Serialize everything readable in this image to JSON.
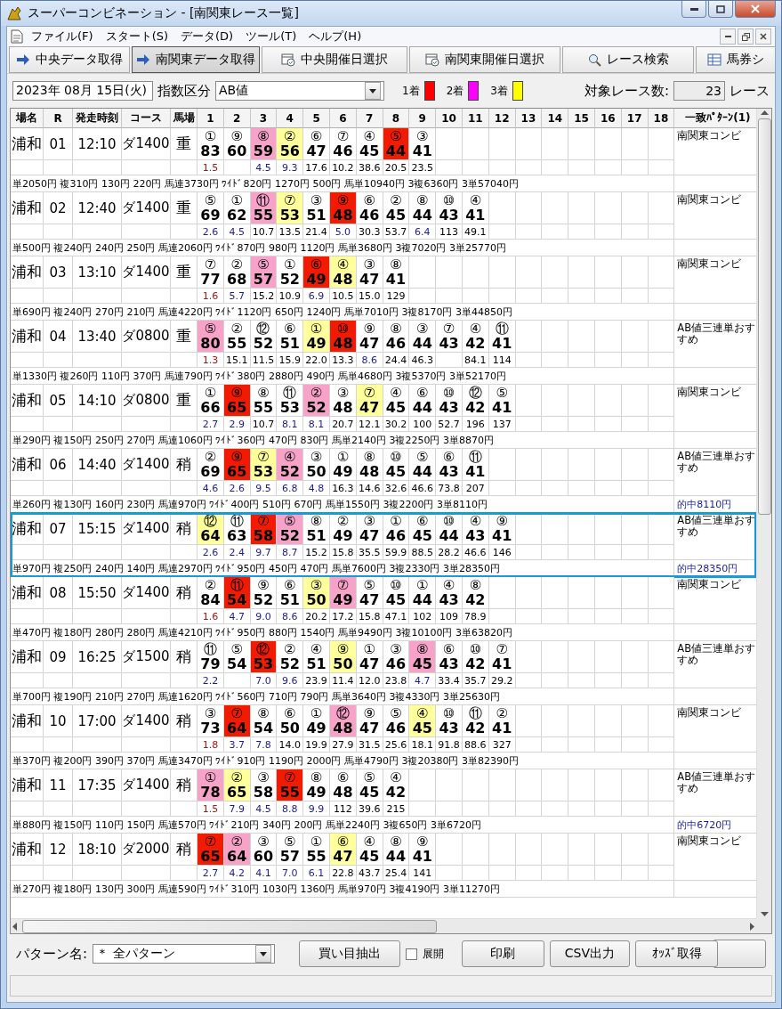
{
  "window": {
    "title": "スーパーコンビネーション - [南関東レース一覧]"
  },
  "menu": [
    "ファイル(F)",
    "スタート(S)",
    "データ(D)",
    "ツール(T)",
    "ヘルプ(H)"
  ],
  "toolbar": [
    {
      "label": "中央データ取得",
      "kind": "arrow",
      "selected": false
    },
    {
      "label": "南関東データ取得",
      "kind": "arrow",
      "selected": true
    },
    {
      "label": "中央開催日選択",
      "kind": "calendar",
      "selected": false
    },
    {
      "label": "南関東開催日選択",
      "kind": "calendar",
      "selected": false
    },
    {
      "label": "レース検索",
      "kind": "search",
      "selected": false
    },
    {
      "label": "馬券シ",
      "kind": "table",
      "selected": false
    }
  ],
  "filter": {
    "date": "2023年 08月 15日(火)",
    "index_label": "指数区分",
    "index_value": "AB値",
    "legend": [
      {
        "label": "1着",
        "color": "#ff0000"
      },
      {
        "label": "2着",
        "color": "#ff00ff"
      },
      {
        "label": "3着",
        "color": "#ffff00"
      }
    ],
    "count_label": "対象レース数:",
    "count": "23",
    "count_unit": "レース"
  },
  "table": {
    "columns": [
      "場名",
      "R",
      "発走時刻",
      "コース",
      "馬場",
      "1",
      "2",
      "3",
      "4",
      "5",
      "6",
      "7",
      "8",
      "9",
      "10",
      "11",
      "12",
      "13",
      "14",
      "15",
      "16",
      "17",
      "18",
      "一致ﾊﾟﾀｰﾝ(1)"
    ]
  },
  "races": [
    {
      "venue": "浦和",
      "r": "01",
      "time": "12:10",
      "course": "ダ1400",
      "track": "重",
      "selected": false,
      "pattern": "南関東コンビ",
      "payout": "単2050円 複310円 130円 220円 馬連3730円 ﾜｲﾄﾞ820円 1270円 500円 馬単10940円 3複6360円 3単57040円",
      "horses": [
        {
          "no": "①",
          "score": "83",
          "color": "#ffffff",
          "odds": {
            "text": "1.5",
            "color": "#a01818"
          }
        },
        {
          "no": "⑨",
          "score": "60",
          "color": "#ffffff"
        },
        {
          "no": "⑧",
          "score": "59",
          "color": "#f6a2c9",
          "odds": {
            "text": "4.5",
            "color": "#1c1c8c"
          }
        },
        {
          "no": "②",
          "score": "56",
          "color": "#ffff9c",
          "odds": {
            "text": "9.3",
            "color": "#1c1c8c"
          }
        },
        {
          "no": "⑥",
          "score": "47",
          "color": "#ffffff",
          "odds": {
            "text": "17.6",
            "color": "#000000"
          }
        },
        {
          "no": "⑦",
          "score": "46",
          "color": "#ffffff",
          "odds": {
            "text": "10.2",
            "color": "#000000"
          }
        },
        {
          "no": "④",
          "score": "45",
          "color": "#ffffff",
          "odds": {
            "text": "38.6",
            "color": "#000000"
          }
        },
        {
          "no": "⑤",
          "score": "44",
          "color": "#f21a00",
          "odds": {
            "text": "20.5",
            "color": "#000000"
          }
        },
        {
          "no": "③",
          "score": "41",
          "color": "#ffffff",
          "odds": {
            "text": "23.5",
            "color": "#000000"
          }
        }
      ]
    },
    {
      "venue": "浦和",
      "r": "02",
      "time": "12:40",
      "course": "ダ1400",
      "track": "重",
      "selected": false,
      "pattern": "南関東コンビ",
      "payout": "単500円 複240円 240円 250円 馬連2060円 ﾜｲﾄﾞ870円 980円 1120円 馬単3680円 3複7020円 3単25770円",
      "horses": [
        {
          "no": "⑤",
          "score": "69",
          "color": "#ffffff",
          "odds": {
            "text": "2.6",
            "color": "#1c1c8c"
          }
        },
        {
          "no": "①",
          "score": "62",
          "color": "#ffffff",
          "odds": {
            "text": "4.5",
            "color": "#1c1c8c"
          }
        },
        {
          "no": "⑪",
          "score": "55",
          "color": "#f6a2c9",
          "odds": {
            "text": "10.7",
            "color": "#000000"
          }
        },
        {
          "no": "⑦",
          "score": "53",
          "color": "#ffff9c",
          "odds": {
            "text": "13.5",
            "color": "#000000"
          }
        },
        {
          "no": "③",
          "score": "51",
          "color": "#ffffff",
          "odds": {
            "text": "21.4",
            "color": "#000000"
          }
        },
        {
          "no": "⑨",
          "score": "48",
          "color": "#f21a00",
          "odds": {
            "text": "5.0",
            "color": "#1c1c8c"
          }
        },
        {
          "no": "⑥",
          "score": "46",
          "color": "#ffffff",
          "odds": {
            "text": "30.3",
            "color": "#000000"
          }
        },
        {
          "no": "②",
          "score": "45",
          "color": "#ffffff",
          "odds": {
            "text": "53.7",
            "color": "#000000"
          }
        },
        {
          "no": "⑧",
          "score": "44",
          "color": "#ffffff",
          "odds": {
            "text": "6.4",
            "color": "#1c1c8c"
          }
        },
        {
          "no": "⑩",
          "score": "43",
          "color": "#ffffff",
          "odds": {
            "text": "113",
            "color": "#000000"
          }
        },
        {
          "no": "④",
          "score": "41",
          "color": "#ffffff",
          "odds": {
            "text": "49.1",
            "color": "#000000"
          }
        }
      ]
    },
    {
      "venue": "浦和",
      "r": "03",
      "time": "13:10",
      "course": "ダ1400",
      "track": "重",
      "selected": false,
      "pattern": "南関東コンビ",
      "payout": "単690円 複240円 270円 210円 馬連4220円 ﾜｲﾄﾞ1120円 650円 1240円 馬単7010円 3複8170円 3単44850円",
      "horses": [
        {
          "no": "⑦",
          "score": "77",
          "color": "#ffffff",
          "odds": {
            "text": "1.6",
            "color": "#a01818"
          }
        },
        {
          "no": "②",
          "score": "68",
          "color": "#ffffff",
          "odds": {
            "text": "5.7",
            "color": "#1c1c8c"
          }
        },
        {
          "no": "⑤",
          "score": "57",
          "color": "#f6a2c9",
          "odds": {
            "text": "15.2",
            "color": "#000000"
          }
        },
        {
          "no": "①",
          "score": "52",
          "color": "#ffffff",
          "odds": {
            "text": "10.9",
            "color": "#000000"
          }
        },
        {
          "no": "⑥",
          "score": "49",
          "color": "#f21a00",
          "odds": {
            "text": "6.9",
            "color": "#1c1c8c"
          }
        },
        {
          "no": "④",
          "score": "48",
          "color": "#ffff9c",
          "odds": {
            "text": "10.5",
            "color": "#000000"
          }
        },
        {
          "no": "③",
          "score": "47",
          "color": "#ffffff",
          "odds": {
            "text": "15.0",
            "color": "#000000"
          }
        },
        {
          "no": "⑧",
          "score": "41",
          "color": "#ffffff",
          "odds": {
            "text": "129",
            "color": "#000000"
          }
        }
      ]
    },
    {
      "venue": "浦和",
      "r": "04",
      "time": "13:40",
      "course": "ダ0800",
      "track": "重",
      "selected": false,
      "pattern": "AB値三連単おすすめ",
      "payout": "単1330円 複260円 110円 370円 馬連790円 ﾜｲﾄﾞ380円 2880円 490円 馬単4680円 3複5370円 3単52170円",
      "horses": [
        {
          "no": "⑤",
          "score": "80",
          "color": "#f6a2c9",
          "odds": {
            "text": "1.3",
            "color": "#a01818"
          }
        },
        {
          "no": "②",
          "score": "55",
          "color": "#ffffff",
          "odds": {
            "text": "15.1",
            "color": "#000000"
          }
        },
        {
          "no": "⑫",
          "score": "52",
          "color": "#ffffff",
          "odds": {
            "text": "11.5",
            "color": "#000000"
          }
        },
        {
          "no": "⑥",
          "score": "51",
          "color": "#ffffff",
          "odds": {
            "text": "15.9",
            "color": "#000000"
          }
        },
        {
          "no": "①",
          "score": "49",
          "color": "#ffff9c",
          "odds": {
            "text": "22.0",
            "color": "#000000"
          }
        },
        {
          "no": "⑩",
          "score": "48",
          "color": "#f21a00",
          "odds": {
            "text": "13.3",
            "color": "#000000"
          }
        },
        {
          "no": "⑨",
          "score": "47",
          "color": "#ffffff",
          "odds": {
            "text": "8.6",
            "color": "#1c1c8c"
          }
        },
        {
          "no": "⑧",
          "score": "46",
          "color": "#ffffff",
          "odds": {
            "text": "24.4",
            "color": "#000000"
          }
        },
        {
          "no": "③",
          "score": "44",
          "color": "#ffffff",
          "odds": {
            "text": "46.3",
            "color": "#000000"
          }
        },
        {
          "no": "⑦",
          "score": "43",
          "color": "#ffffff"
        },
        {
          "no": "④",
          "score": "42",
          "color": "#ffffff",
          "odds": {
            "text": "84.1",
            "color": "#000000"
          }
        },
        {
          "no": "⑪",
          "score": "41",
          "color": "#ffffff",
          "odds": {
            "text": "114",
            "color": "#000000"
          }
        }
      ]
    },
    {
      "venue": "浦和",
      "r": "05",
      "time": "14:10",
      "course": "ダ0800",
      "track": "重",
      "selected": false,
      "pattern": "南関東コンビ",
      "payout": "単290円 複150円 250円 270円 馬連1060円 ﾜｲﾄﾞ360円 470円 830円 馬単2140円 3複2250円 3単8870円",
      "horses": [
        {
          "no": "①",
          "score": "66",
          "color": "#ffffff",
          "odds": {
            "text": "2.7",
            "color": "#1c1c8c"
          }
        },
        {
          "no": "⑨",
          "score": "65",
          "color": "#f21a00",
          "odds": {
            "text": "2.9",
            "color": "#1c1c8c"
          }
        },
        {
          "no": "⑧",
          "score": "55",
          "color": "#ffffff",
          "odds": {
            "text": "10.7",
            "color": "#000000"
          }
        },
        {
          "no": "⑪",
          "score": "53",
          "color": "#ffffff",
          "odds": {
            "text": "8.1",
            "color": "#1c1c8c"
          }
        },
        {
          "no": "②",
          "score": "52",
          "color": "#f6a2c9",
          "odds": {
            "text": "8.1",
            "color": "#1c1c8c"
          }
        },
        {
          "no": "③",
          "score": "48",
          "color": "#ffffff",
          "odds": {
            "text": "20.7",
            "color": "#000000"
          }
        },
        {
          "no": "⑦",
          "score": "47",
          "color": "#ffff9c",
          "odds": {
            "text": "12.1",
            "color": "#000000"
          }
        },
        {
          "no": "④",
          "score": "45",
          "color": "#ffffff",
          "odds": {
            "text": "30.2",
            "color": "#000000"
          }
        },
        {
          "no": "⑥",
          "score": "44",
          "color": "#ffffff",
          "odds": {
            "text": "100",
            "color": "#000000"
          }
        },
        {
          "no": "⑩",
          "score": "43",
          "color": "#ffffff",
          "odds": {
            "text": "52.7",
            "color": "#000000"
          }
        },
        {
          "no": "⑫",
          "score": "42",
          "color": "#ffffff",
          "odds": {
            "text": "196",
            "color": "#000000"
          }
        },
        {
          "no": "⑤",
          "score": "41",
          "color": "#ffffff",
          "odds": {
            "text": "137",
            "color": "#000000"
          }
        }
      ]
    },
    {
      "venue": "浦和",
      "r": "06",
      "time": "14:40",
      "course": "ダ1400",
      "track": "稍",
      "selected": false,
      "pattern": "AB値三連単おすすめ",
      "payout": "単260円 複130円 160円 230円 馬連970円 ﾜｲﾄﾞ400円 510円 670円 馬単1550円 3複2200円 3単8110円",
      "hit": "的中8110円",
      "horses": [
        {
          "no": "②",
          "score": "69",
          "color": "#ffffff",
          "odds": {
            "text": "4.6",
            "color": "#1c1c8c"
          }
        },
        {
          "no": "⑨",
          "score": "65",
          "color": "#f21a00",
          "odds": {
            "text": "2.6",
            "color": "#1c1c8c"
          }
        },
        {
          "no": "⑦",
          "score": "53",
          "color": "#ffff9c",
          "odds": {
            "text": "9.5",
            "color": "#1c1c8c"
          }
        },
        {
          "no": "④",
          "score": "52",
          "color": "#f6a2c9",
          "odds": {
            "text": "6.8",
            "color": "#1c1c8c"
          }
        },
        {
          "no": "③",
          "score": "50",
          "color": "#ffffff",
          "odds": {
            "text": "4.8",
            "color": "#1c1c8c"
          }
        },
        {
          "no": "①",
          "score": "49",
          "color": "#ffffff",
          "odds": {
            "text": "16.3",
            "color": "#000000"
          }
        },
        {
          "no": "⑧",
          "score": "48",
          "color": "#ffffff",
          "odds": {
            "text": "14.6",
            "color": "#000000"
          }
        },
        {
          "no": "⑩",
          "score": "45",
          "color": "#ffffff",
          "odds": {
            "text": "32.6",
            "color": "#000000"
          }
        },
        {
          "no": "⑤",
          "score": "44",
          "color": "#ffffff",
          "odds": {
            "text": "46.6",
            "color": "#000000"
          }
        },
        {
          "no": "⑥",
          "score": "43",
          "color": "#ffffff",
          "odds": {
            "text": "73.8",
            "color": "#000000"
          }
        },
        {
          "no": "⑪",
          "score": "41",
          "color": "#ffffff",
          "odds": {
            "text": "207",
            "color": "#000000"
          }
        }
      ]
    },
    {
      "venue": "浦和",
      "r": "07",
      "time": "15:15",
      "course": "ダ1400",
      "track": "稍",
      "selected": true,
      "pattern": "AB値三連単おすすめ",
      "payout": "単970円 複250円 240円 140円 馬連2970円 ﾜｲﾄﾞ950円 450円 470円 馬単7600円 3複2330円 3単28350円",
      "hit": "的中28350円",
      "horses": [
        {
          "no": "⑫",
          "score": "64",
          "color": "#ffff9c",
          "odds": {
            "text": "2.6",
            "color": "#1c1c8c"
          }
        },
        {
          "no": "⑪",
          "score": "63",
          "color": "#ffffff",
          "odds": {
            "text": "2.4",
            "color": "#1c1c8c"
          }
        },
        {
          "no": "⑦",
          "score": "58",
          "color": "#f21a00",
          "odds": {
            "text": "9.7",
            "color": "#1c1c8c"
          }
        },
        {
          "no": "⑤",
          "score": "52",
          "color": "#f6a2c9",
          "odds": {
            "text": "8.7",
            "color": "#1c1c8c"
          }
        },
        {
          "no": "⑧",
          "score": "51",
          "color": "#ffffff",
          "odds": {
            "text": "15.2",
            "color": "#000000"
          }
        },
        {
          "no": "②",
          "score": "49",
          "color": "#ffffff",
          "odds": {
            "text": "15.8",
            "color": "#000000"
          }
        },
        {
          "no": "③",
          "score": "47",
          "color": "#ffffff",
          "odds": {
            "text": "35.5",
            "color": "#000000"
          }
        },
        {
          "no": "①",
          "score": "46",
          "color": "#ffffff",
          "odds": {
            "text": "59.9",
            "color": "#000000"
          }
        },
        {
          "no": "⑥",
          "score": "45",
          "color": "#ffffff",
          "odds": {
            "text": "88.5",
            "color": "#000000"
          }
        },
        {
          "no": "⑩",
          "score": "44",
          "color": "#ffffff",
          "odds": {
            "text": "28.2",
            "color": "#000000"
          }
        },
        {
          "no": "④",
          "score": "43",
          "color": "#ffffff",
          "odds": {
            "text": "46.6",
            "color": "#000000"
          }
        },
        {
          "no": "⑨",
          "score": "41",
          "color": "#ffffff",
          "odds": {
            "text": "146",
            "color": "#000000"
          }
        }
      ]
    },
    {
      "venue": "浦和",
      "r": "08",
      "time": "15:50",
      "course": "ダ1400",
      "track": "稍",
      "selected": false,
      "pattern": "南関東コンビ",
      "payout": "単470円 複180円 280円 280円 馬連4210円 ﾜｲﾄﾞ950円 880円 1540円 馬単9490円 3複10100円 3単63820円",
      "horses": [
        {
          "no": "②",
          "score": "84",
          "color": "#ffffff",
          "odds": {
            "text": "1.6",
            "color": "#a01818"
          }
        },
        {
          "no": "⑪",
          "score": "54",
          "color": "#f21a00",
          "odds": {
            "text": "4.7",
            "color": "#1c1c8c"
          }
        },
        {
          "no": "⑨",
          "score": "52",
          "color": "#ffffff",
          "odds": {
            "text": "9.0",
            "color": "#1c1c8c"
          }
        },
        {
          "no": "⑥",
          "score": "51",
          "color": "#ffffff",
          "odds": {
            "text": "8.6",
            "color": "#1c1c8c"
          }
        },
        {
          "no": "③",
          "score": "50",
          "color": "#ffff9c",
          "odds": {
            "text": "20.2",
            "color": "#000000"
          }
        },
        {
          "no": "⑦",
          "score": "49",
          "color": "#f6a2c9",
          "odds": {
            "text": "17.2",
            "color": "#000000"
          }
        },
        {
          "no": "⑤",
          "score": "47",
          "color": "#ffffff",
          "odds": {
            "text": "15.8",
            "color": "#000000"
          }
        },
        {
          "no": "⑩",
          "score": "45",
          "color": "#ffffff",
          "odds": {
            "text": "47.1",
            "color": "#000000"
          }
        },
        {
          "no": "①",
          "score": "44",
          "color": "#ffffff",
          "odds": {
            "text": "102",
            "color": "#000000"
          }
        },
        {
          "no": "④",
          "score": "43",
          "color": "#ffffff",
          "odds": {
            "text": "109",
            "color": "#000000"
          }
        },
        {
          "no": "⑧",
          "score": "42",
          "color": "#ffffff",
          "odds": {
            "text": "78.9",
            "color": "#000000"
          }
        }
      ]
    },
    {
      "venue": "浦和",
      "r": "09",
      "time": "16:25",
      "course": "ダ1500",
      "track": "稍",
      "selected": false,
      "pattern": "AB値三連単おすすめ",
      "payout": "単700円 複190円 210円 270円 馬連1620円 ﾜｲﾄﾞ560円 710円 790円 馬単3640円 3複4330円 3単25630円",
      "horses": [
        {
          "no": "⑪",
          "score": "79",
          "color": "#ffffff",
          "odds": {
            "text": "2.2",
            "color": "#1c1c8c"
          }
        },
        {
          "no": "⑤",
          "score": "54",
          "color": "#ffffff"
        },
        {
          "no": "⑫",
          "score": "53",
          "color": "#f21a00",
          "odds": {
            "text": "7.0",
            "color": "#1c1c8c"
          }
        },
        {
          "no": "②",
          "score": "52",
          "color": "#ffffff",
          "odds": {
            "text": "9.6",
            "color": "#1c1c8c"
          }
        },
        {
          "no": "④",
          "score": "51",
          "color": "#ffffff",
          "odds": {
            "text": "23.9",
            "color": "#000000"
          }
        },
        {
          "no": "⑨",
          "score": "50",
          "color": "#ffff9c",
          "odds": {
            "text": "11.4",
            "color": "#000000"
          }
        },
        {
          "no": "①",
          "score": "47",
          "color": "#ffffff",
          "odds": {
            "text": "12.0",
            "color": "#000000"
          }
        },
        {
          "no": "③",
          "score": "46",
          "color": "#ffffff",
          "odds": {
            "text": "23.8",
            "color": "#000000"
          }
        },
        {
          "no": "⑧",
          "score": "45",
          "color": "#f6a2c9",
          "odds": {
            "text": "4.7",
            "color": "#1c1c8c"
          }
        },
        {
          "no": "⑥",
          "score": "43",
          "color": "#ffffff",
          "odds": {
            "text": "33.4",
            "color": "#000000"
          }
        },
        {
          "no": "⑩",
          "score": "42",
          "color": "#ffffff",
          "odds": {
            "text": "35.7",
            "color": "#000000"
          }
        },
        {
          "no": "⑦",
          "score": "41",
          "color": "#ffffff",
          "odds": {
            "text": "29.2",
            "color": "#000000"
          }
        }
      ]
    },
    {
      "venue": "浦和",
      "r": "10",
      "time": "17:00",
      "course": "ダ1400",
      "track": "稍",
      "selected": false,
      "pattern": "南関東コンビ",
      "payout": "単370円 複200円 390円 370円 馬連3470円 ﾜｲﾄﾞ910円 1190円 2000円 馬単4790円 3複20380円 3単82390円",
      "horses": [
        {
          "no": "③",
          "score": "73",
          "color": "#ffffff",
          "odds": {
            "text": "1.8",
            "color": "#a01818"
          }
        },
        {
          "no": "⑦",
          "score": "64",
          "color": "#f21a00",
          "odds": {
            "text": "3.7",
            "color": "#1c1c8c"
          }
        },
        {
          "no": "⑧",
          "score": "54",
          "color": "#ffffff",
          "odds": {
            "text": "7.8",
            "color": "#1c1c8c"
          }
        },
        {
          "no": "⑥",
          "score": "50",
          "color": "#ffffff",
          "odds": {
            "text": "14.0",
            "color": "#000000"
          }
        },
        {
          "no": "①",
          "score": "49",
          "color": "#ffffff",
          "odds": {
            "text": "19.9",
            "color": "#000000"
          }
        },
        {
          "no": "⑫",
          "score": "48",
          "color": "#f6a2c9",
          "odds": {
            "text": "27.9",
            "color": "#000000"
          }
        },
        {
          "no": "⑨",
          "score": "47",
          "color": "#ffffff",
          "odds": {
            "text": "31.5",
            "color": "#000000"
          }
        },
        {
          "no": "⑤",
          "score": "46",
          "color": "#ffffff",
          "odds": {
            "text": "25.6",
            "color": "#000000"
          }
        },
        {
          "no": "④",
          "score": "45",
          "color": "#ffff9c",
          "odds": {
            "text": "18.1",
            "color": "#000000"
          }
        },
        {
          "no": "⑩",
          "score": "43",
          "color": "#ffffff",
          "odds": {
            "text": "91.8",
            "color": "#000000"
          }
        },
        {
          "no": "⑪",
          "score": "42",
          "color": "#ffffff",
          "odds": {
            "text": "88.6",
            "color": "#000000"
          }
        },
        {
          "no": "②",
          "score": "41",
          "color": "#ffffff",
          "odds": {
            "text": "327",
            "color": "#000000"
          }
        }
      ]
    },
    {
      "venue": "浦和",
      "r": "11",
      "time": "17:35",
      "course": "ダ1400",
      "track": "稍",
      "selected": false,
      "pattern": "AB値三連単おすすめ",
      "payout": "単880円 複150円 110円 150円 馬連570円 ﾜｲﾄﾞ210円 340円 200円 馬単2240円 3複650円 3単6720円",
      "hit": "的中6720円",
      "horses": [
        {
          "no": "①",
          "score": "78",
          "color": "#f6a2c9",
          "odds": {
            "text": "1.5",
            "color": "#a01818"
          }
        },
        {
          "no": "②",
          "score": "65",
          "color": "#ffff9c",
          "odds": {
            "text": "7.9",
            "color": "#1c1c8c"
          }
        },
        {
          "no": "③",
          "score": "58",
          "color": "#ffffff",
          "odds": {
            "text": "4.5",
            "color": "#1c1c8c"
          }
        },
        {
          "no": "⑦",
          "score": "55",
          "color": "#f21a00",
          "odds": {
            "text": "8.8",
            "color": "#1c1c8c"
          }
        },
        {
          "no": "⑧",
          "score": "49",
          "color": "#ffffff",
          "odds": {
            "text": "9.9",
            "color": "#1c1c8c"
          }
        },
        {
          "no": "⑥",
          "score": "48",
          "color": "#ffffff",
          "odds": {
            "text": "112",
            "color": "#000000"
          }
        },
        {
          "no": "⑤",
          "score": "45",
          "color": "#ffffff",
          "odds": {
            "text": "39.6",
            "color": "#000000"
          }
        },
        {
          "no": "④",
          "score": "42",
          "color": "#ffffff",
          "odds": {
            "text": "215",
            "color": "#000000"
          }
        }
      ]
    },
    {
      "venue": "浦和",
      "r": "12",
      "time": "18:10",
      "course": "ダ2000",
      "track": "稍",
      "selected": false,
      "pattern": "南関東コンビ",
      "payout": "単270円 複180円 130円 300円 馬連590円 ﾜｲﾄﾞ310円 1030円 1360円 馬単970円 3複4190円 3単11270円",
      "horses": [
        {
          "no": "⑦",
          "score": "65",
          "color": "#f21a00",
          "odds": {
            "text": "2.7",
            "color": "#1c1c8c"
          }
        },
        {
          "no": "②",
          "score": "64",
          "color": "#f6a2c9",
          "odds": {
            "text": "4.2",
            "color": "#1c1c8c"
          }
        },
        {
          "no": "③",
          "score": "60",
          "color": "#ffffff",
          "odds": {
            "text": "4.1",
            "color": "#1c1c8c"
          }
        },
        {
          "no": "⑤",
          "score": "57",
          "color": "#ffffff",
          "odds": {
            "text": "7.0",
            "color": "#1c1c8c"
          }
        },
        {
          "no": "①",
          "score": "55",
          "color": "#ffffff",
          "odds": {
            "text": "6.1",
            "color": "#1c1c8c"
          }
        },
        {
          "no": "⑥",
          "score": "47",
          "color": "#ffff9c",
          "odds": {
            "text": "22.8",
            "color": "#000000"
          }
        },
        {
          "no": "④",
          "score": "45",
          "color": "#ffffff",
          "odds": {
            "text": "43.7",
            "color": "#000000"
          }
        },
        {
          "no": "⑧",
          "score": "44",
          "color": "#ffffff",
          "odds": {
            "text": "25.4",
            "color": "#000000"
          }
        },
        {
          "no": "⑨",
          "score": "41",
          "color": "#ffffff",
          "odds": {
            "text": "141",
            "color": "#000000"
          }
        }
      ]
    }
  ],
  "bottom": {
    "pattern_label": "パターン名:",
    "pattern_value": "＊ 全パターン",
    "extract_button": "買い目抽出",
    "expand": {
      "label": "展開",
      "checked": false
    },
    "print_button": "印刷",
    "csv_button": "CSV出力",
    "odds_button": "ｵｯｽﾞ取得"
  }
}
